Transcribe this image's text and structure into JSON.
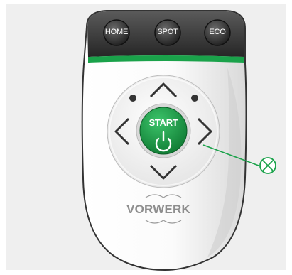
{
  "remote": {
    "buttons": {
      "home": {
        "label": "HOME"
      },
      "spot": {
        "label": "SPOT"
      },
      "eco": {
        "label": "ECO"
      }
    },
    "start": {
      "label": "START",
      "icon": "power-icon"
    },
    "brand": {
      "text": "VORWERK"
    },
    "colors": {
      "accent_green": "#1aa24a",
      "body_dark": "#3a3a3a",
      "callout": "#1aa24a"
    },
    "callout": {
      "icon": "circle-x-icon"
    }
  }
}
